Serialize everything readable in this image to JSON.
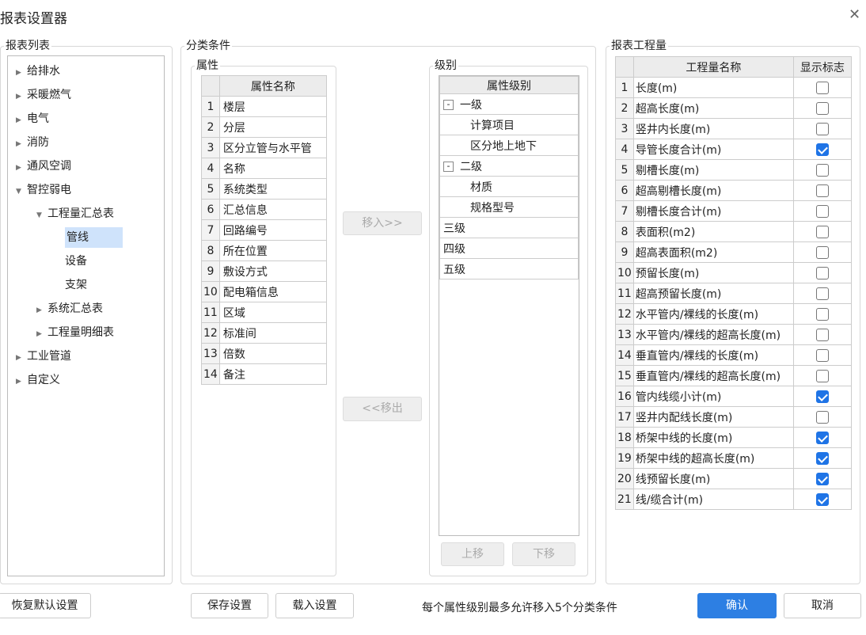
{
  "window": {
    "title": "报表设置器",
    "close_icon": "close-icon"
  },
  "report_list": {
    "label": "报表列表",
    "items": [
      {
        "label": "给排水",
        "level": 0,
        "expanded": false
      },
      {
        "label": "采暖燃气",
        "level": 0,
        "expanded": false
      },
      {
        "label": "电气",
        "level": 0,
        "expanded": false
      },
      {
        "label": "消防",
        "level": 0,
        "expanded": false
      },
      {
        "label": "通风空调",
        "level": 0,
        "expanded": false
      },
      {
        "label": "智控弱电",
        "level": 0,
        "expanded": true
      },
      {
        "label": "工程量汇总表",
        "level": 1,
        "expanded": true
      },
      {
        "label": "管线",
        "level": 2,
        "selected": true
      },
      {
        "label": "设备",
        "level": 2
      },
      {
        "label": "支架",
        "level": 2
      },
      {
        "label": "系统汇总表",
        "level": 1,
        "expanded": false
      },
      {
        "label": "工程量明细表",
        "level": 1,
        "expanded": false
      },
      {
        "label": "工业管道",
        "level": 0,
        "expanded": false
      },
      {
        "label": "自定义",
        "level": 0,
        "expanded": false
      }
    ]
  },
  "classification": {
    "label": "分类条件",
    "attributes": {
      "label": "属性",
      "header": "属性名称",
      "rows": [
        "楼层",
        "分层",
        "区分立管与水平管",
        "名称",
        "系统类型",
        "汇总信息",
        "回路编号",
        "所在位置",
        "敷设方式",
        "配电箱信息",
        "区域",
        "标准间",
        "倍数",
        "备注"
      ]
    },
    "move_in": "移入>>",
    "move_out": "<<移出",
    "levels": {
      "label": "级别",
      "header": "属性级别",
      "rows": [
        {
          "label": "一级",
          "type": "level",
          "collapse": "-"
        },
        {
          "label": "计算项目",
          "type": "child"
        },
        {
          "label": "区分地上地下",
          "type": "child"
        },
        {
          "label": "二级",
          "type": "level",
          "collapse": "-"
        },
        {
          "label": "材质",
          "type": "child"
        },
        {
          "label": "规格型号",
          "type": "child"
        },
        {
          "label": "三级",
          "type": "plain"
        },
        {
          "label": "四级",
          "type": "plain"
        },
        {
          "label": "五级",
          "type": "plain"
        }
      ]
    },
    "move_up": "上移",
    "move_down": "下移"
  },
  "quantities": {
    "label": "报表工程量",
    "headers": [
      "工程量名称",
      "显示标志"
    ],
    "rows": [
      {
        "name": "长度(m)",
        "checked": false
      },
      {
        "name": "超高长度(m)",
        "checked": false
      },
      {
        "name": "竖井内长度(m)",
        "checked": false
      },
      {
        "name": "导管长度合计(m)",
        "checked": true
      },
      {
        "name": "剔槽长度(m)",
        "checked": false
      },
      {
        "name": "超高剔槽长度(m)",
        "checked": false
      },
      {
        "name": "剔槽长度合计(m)",
        "checked": false
      },
      {
        "name": "表面积(m2)",
        "checked": false
      },
      {
        "name": "超高表面积(m2)",
        "checked": false
      },
      {
        "name": "预留长度(m)",
        "checked": false
      },
      {
        "name": "超高预留长度(m)",
        "checked": false
      },
      {
        "name": "水平管内/裸线的长度(m)",
        "checked": false
      },
      {
        "name": "水平管内/裸线的超高长度(m)",
        "checked": false
      },
      {
        "name": "垂直管内/裸线的长度(m)",
        "checked": false
      },
      {
        "name": "垂直管内/裸线的超高长度(m)",
        "checked": false
      },
      {
        "name": "管内线缆小计(m)",
        "checked": true
      },
      {
        "name": "竖井内配线长度(m)",
        "checked": false
      },
      {
        "name": "桥架中线的长度(m)",
        "checked": true
      },
      {
        "name": "桥架中线的超高长度(m)",
        "checked": true
      },
      {
        "name": "线预留长度(m)",
        "checked": true
      },
      {
        "name": "线/缆合计(m)",
        "checked": true
      }
    ]
  },
  "footer": {
    "restore": "恢复默认设置",
    "save": "保存设置",
    "load": "载入设置",
    "hint": "每个属性级别最多允许移入5个分类条件",
    "ok": "确认",
    "cancel": "取消"
  },
  "colors": {
    "accent": "#2d7fe3",
    "selection": "#cfe3fb"
  }
}
